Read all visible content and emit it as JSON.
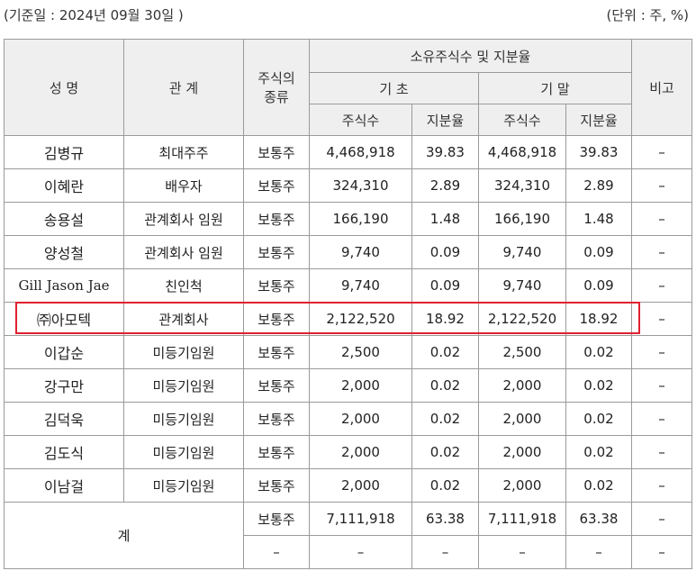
{
  "header": {
    "base_date": "(기준일 :        2024년 09월 30일    )",
    "unit": "(단위 : 주, %)"
  },
  "table": {
    "headers": {
      "name": "성 명",
      "relation": "관 계",
      "stock_type_line1": "주식의",
      "stock_type_line2": "종류",
      "group": "소유주식수 및 지분율",
      "begin": "기 초",
      "end": "기 말",
      "shares": "주식수",
      "ratio": "지분율",
      "note": "비고"
    },
    "rows": [
      {
        "name": "김병규",
        "relation": "최대주주",
        "type": "보통주",
        "begin_shares": "4,468,918",
        "begin_ratio": "39.83",
        "end_shares": "4,468,918",
        "end_ratio": "39.83",
        "note": "–"
      },
      {
        "name": "이혜란",
        "relation": "배우자",
        "type": "보통주",
        "begin_shares": "324,310",
        "begin_ratio": "2.89",
        "end_shares": "324,310",
        "end_ratio": "2.89",
        "note": "–"
      },
      {
        "name": "송용설",
        "relation": "관계회사 임원",
        "type": "보통주",
        "begin_shares": "166,190",
        "begin_ratio": "1.48",
        "end_shares": "166,190",
        "end_ratio": "1.48",
        "note": "–"
      },
      {
        "name": "양성철",
        "relation": "관계회사 임원",
        "type": "보통주",
        "begin_shares": "9,740",
        "begin_ratio": "0.09",
        "end_shares": "9,740",
        "end_ratio": "0.09",
        "note": "–"
      },
      {
        "name": "Gill Jason Jae",
        "relation": "친인척",
        "type": "보통주",
        "begin_shares": "9,740",
        "begin_ratio": "0.09",
        "end_shares": "9,740",
        "end_ratio": "0.09",
        "note": "–"
      },
      {
        "name": "㈜아모텍",
        "relation": "관계회사",
        "type": "보통주",
        "begin_shares": "2,122,520",
        "begin_ratio": "18.92",
        "end_shares": "2,122,520",
        "end_ratio": "18.92",
        "note": "–"
      },
      {
        "name": "이갑순",
        "relation": "미등기임원",
        "type": "보통주",
        "begin_shares": "2,500",
        "begin_ratio": "0.02",
        "end_shares": "2,500",
        "end_ratio": "0.02",
        "note": "–"
      },
      {
        "name": "강구만",
        "relation": "미등기임원",
        "type": "보통주",
        "begin_shares": "2,000",
        "begin_ratio": "0.02",
        "end_shares": "2,000",
        "end_ratio": "0.02",
        "note": "–"
      },
      {
        "name": "김덕욱",
        "relation": "미등기임원",
        "type": "보통주",
        "begin_shares": "2,000",
        "begin_ratio": "0.02",
        "end_shares": "2,000",
        "end_ratio": "0.02",
        "note": "–"
      },
      {
        "name": "김도식",
        "relation": "미등기임원",
        "type": "보통주",
        "begin_shares": "2,000",
        "begin_ratio": "0.02",
        "end_shares": "2,000",
        "end_ratio": "0.02",
        "note": "–"
      },
      {
        "name": "이남걸",
        "relation": "미등기임원",
        "type": "보통주",
        "begin_shares": "2,000",
        "begin_ratio": "0.02",
        "end_shares": "2,000",
        "end_ratio": "0.02",
        "note": "–"
      }
    ],
    "total": {
      "label": "계",
      "row1": {
        "type": "보통주",
        "begin_shares": "7,111,918",
        "begin_ratio": "63.38",
        "end_shares": "7,111,918",
        "end_ratio": "63.38",
        "note": "–"
      },
      "row2": {
        "type": "–",
        "begin_shares": "–",
        "begin_ratio": "–",
        "end_shares": "–",
        "end_ratio": "–",
        "note": "–"
      }
    }
  },
  "highlight_color": "#e02030"
}
